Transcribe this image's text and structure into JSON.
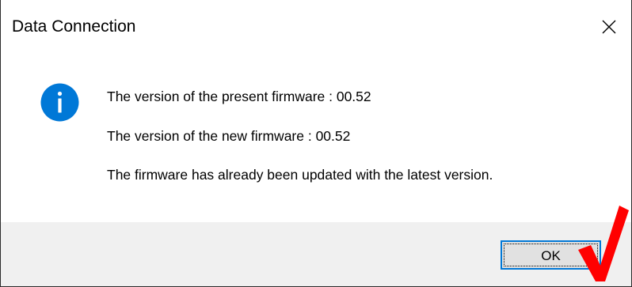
{
  "window": {
    "title": "Data Connection",
    "close_icon": "close-icon"
  },
  "message": {
    "icon": "info-icon",
    "icon_color": "#0078d7",
    "line1": "The version of the present firmware : 00.52",
    "line2": "The version of the new firmware : 00.52",
    "line3": "The firmware has already been updated with the latest version."
  },
  "buttons": {
    "ok_label": "OK"
  },
  "annotation": {
    "icon": "red-checkmark-icon",
    "color": "#ff0000"
  }
}
